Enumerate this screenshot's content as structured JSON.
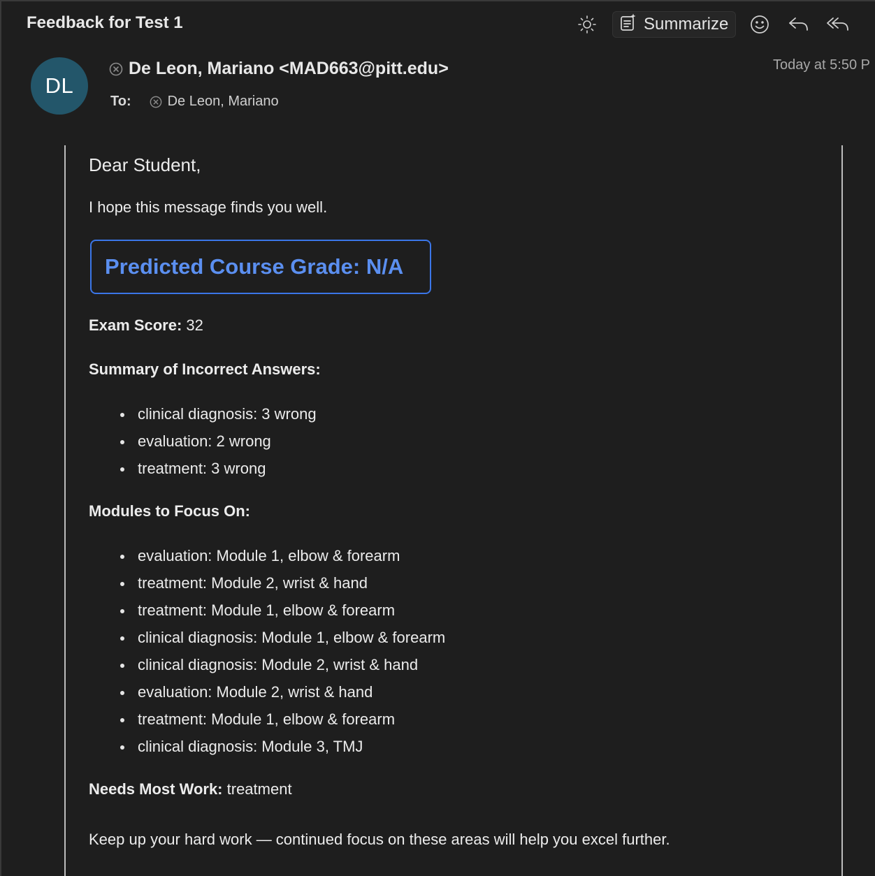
{
  "message": {
    "subject": "Feedback for Test 1",
    "timestamp": "Today at 5:50 P"
  },
  "toolbar": {
    "summarize_label": "Summarize",
    "icons": [
      "brightness-icon",
      "summarize-icon",
      "emoji-icon",
      "reply-icon",
      "reply-all-icon"
    ]
  },
  "sender": {
    "initials": "DL",
    "display": "De Leon, Mariano <MAD663@pitt.edu>",
    "avatar_color": "#23566a"
  },
  "recipients": {
    "label": "To:",
    "name": "De Leon, Mariano"
  },
  "body": {
    "greeting": "Dear Student,",
    "intro": "I hope this message finds you well.",
    "predicted_grade": "Predicted Course Grade: N/A",
    "exam_score_label": "Exam Score:",
    "exam_score_value": " 32",
    "incorrect_heading": "Summary of Incorrect Answers:",
    "incorrect_items": [
      "clinical diagnosis: 3 wrong",
      "evaluation: 2 wrong",
      "treatment: 3 wrong"
    ],
    "modules_heading": "Modules to Focus On:",
    "module_items": [
      "evaluation: Module 1, elbow & forearm",
      "treatment: Module 2, wrist & hand",
      "treatment: Module 1, elbow & forearm",
      "clinical diagnosis: Module 1, elbow & forearm",
      "clinical diagnosis: Module 2, wrist & hand",
      "evaluation: Module 2, wrist & hand",
      "treatment: Module 1, elbow & forearm",
      "clinical diagnosis: Module 3, TMJ"
    ],
    "needs_label": "Needs Most Work:",
    "needs_value": " treatment",
    "closing": "Keep up your hard work — continued focus on these areas will help you excel further."
  },
  "colors": {
    "background": "#1e1e1e",
    "grade_accent": "#3b76e8",
    "grade_text": "#5b8ff0"
  }
}
